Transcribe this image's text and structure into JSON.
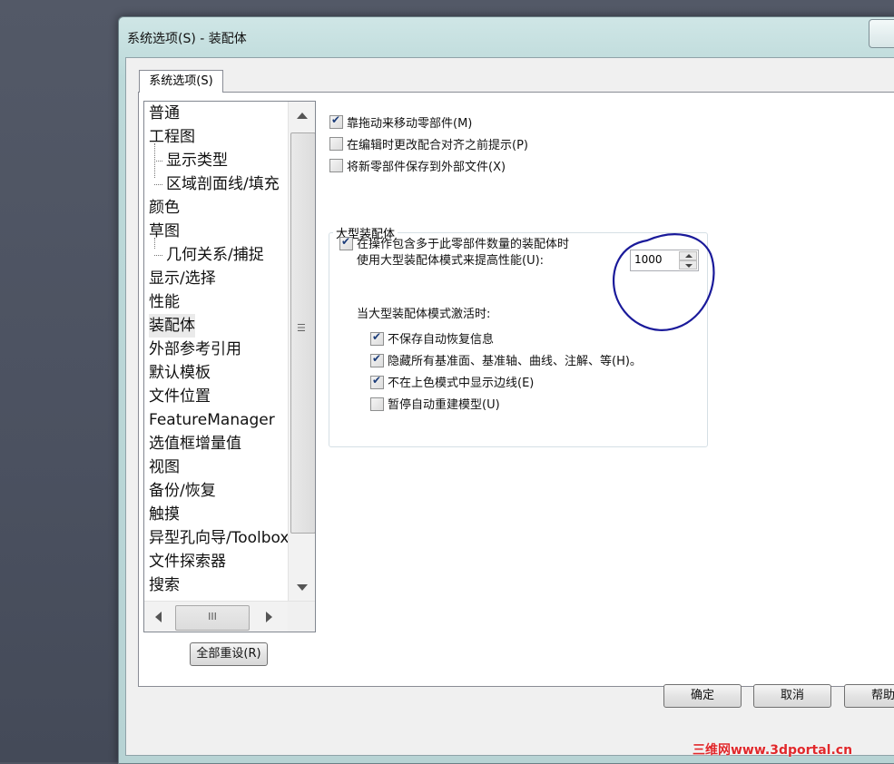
{
  "window": {
    "title": "系统选项(S) - 装配体"
  },
  "tabs": [
    {
      "label": "系统选项(S)"
    }
  ],
  "tree": {
    "items": [
      {
        "label": "普通"
      },
      {
        "label": "工程图"
      },
      {
        "label": "显示类型"
      },
      {
        "label": "区域剖面线/填充"
      },
      {
        "label": "颜色"
      },
      {
        "label": "草图"
      },
      {
        "label": "几何关系/捕捉"
      },
      {
        "label": "显示/选择"
      },
      {
        "label": "性能"
      },
      {
        "label": "装配体"
      },
      {
        "label": "外部参考引用"
      },
      {
        "label": "默认模板"
      },
      {
        "label": "文件位置"
      },
      {
        "label": "FeatureManager"
      },
      {
        "label": "选值框增量值"
      },
      {
        "label": "视图"
      },
      {
        "label": "备份/恢复"
      },
      {
        "label": "触摸"
      },
      {
        "label": "异型孔向导/Toolbox"
      },
      {
        "label": "文件探索器"
      },
      {
        "label": "搜索"
      }
    ],
    "selected": "装配体",
    "hscroll_grip": "III",
    "vscroll_grip": "☰"
  },
  "reset_button": "全部重设(R)",
  "options": {
    "drag_move": {
      "label": "靠拖动来移动零部件(M)",
      "checked": true
    },
    "prompt_before_change": {
      "label": "在编辑时更改配合对齐之前提示(P)",
      "checked": false
    },
    "save_new_external": {
      "label": "将新零部件保存到外部文件(X)",
      "checked": false
    }
  },
  "large_assembly": {
    "group_title": "大型装配体",
    "use_large_mode_line1": "在操作包含多于此零部件数量的装配体时",
    "use_large_mode_line2": "使用大型装配体模式来提高性能(U):",
    "use_large_mode_checked": true,
    "threshold_value": "1000",
    "when_active_label": "当大型装配体模式激活时:",
    "sub_options": [
      {
        "label": "不保存自动恢复信息",
        "checked": true
      },
      {
        "label": "隐藏所有基准面、基准轴、曲线、注解、等(H)。",
        "checked": true
      },
      {
        "label": "不在上色模式中显示边线(E)",
        "checked": true
      },
      {
        "label": "暂停自动重建模型(U)",
        "checked": false
      }
    ]
  },
  "footer_buttons": {
    "ok": "确定",
    "cancel": "取消",
    "help": "帮助"
  },
  "watermark": "三维网www.3dportal.cn",
  "colors": {
    "annotation_circle": "#1a1a9a",
    "watermark": "#e0282b"
  }
}
